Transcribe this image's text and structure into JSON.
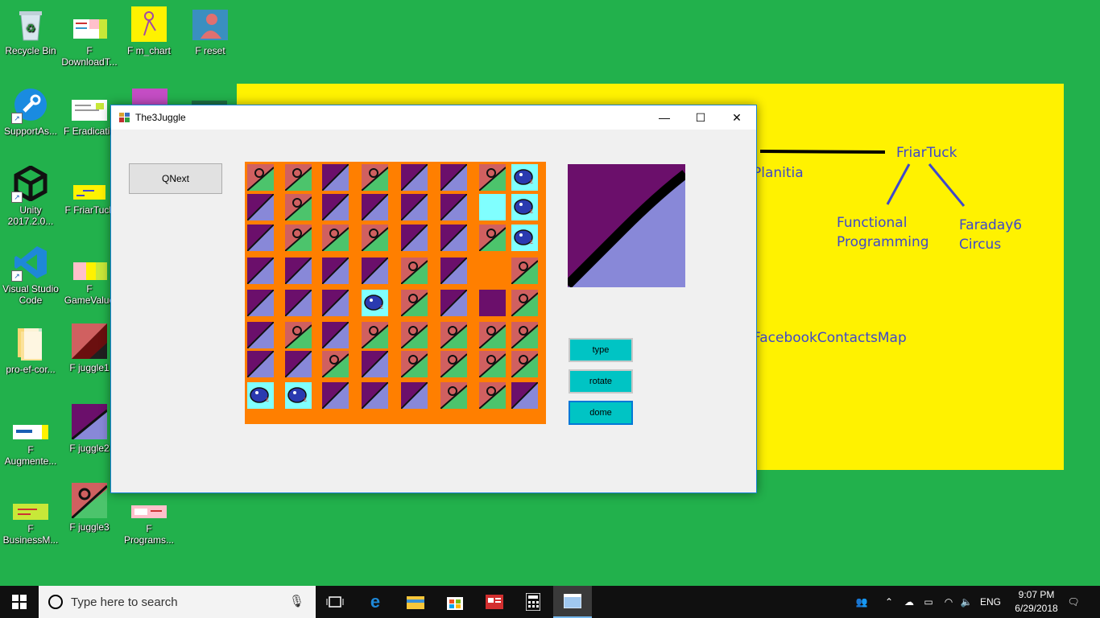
{
  "desktop": {
    "icons": [
      {
        "label": "Recycle Bin"
      },
      {
        "label": "F\nDownloadT..."
      },
      {
        "label": "F m_chart"
      },
      {
        "label": "F reset"
      },
      {
        "label": "SupportAs..."
      },
      {
        "label": "F Eradicatio"
      },
      {
        "label": "Unity\n2017.2.0..."
      },
      {
        "label": "F FriarTuck"
      },
      {
        "label": "Visual Studio\nCode"
      },
      {
        "label": "F\nGameValue"
      },
      {
        "label": "pro-ef-cor..."
      },
      {
        "label": "F juggle1"
      },
      {
        "label": "F\nAugmente..."
      },
      {
        "label": "F juggle2"
      },
      {
        "label": "F\nBusinessM..."
      },
      {
        "label": "F juggle3"
      },
      {
        "label": "F\nPrograms..."
      }
    ],
    "paint": {
      "texts": [
        "FriarTuck",
        "Planitia",
        "Functional\nProgramming",
        "Faraday6\nCircus",
        "FacebookContactsMap"
      ],
      "text_color": "#3f48cc",
      "background": "#fff200"
    }
  },
  "window": {
    "title": "The3Juggle",
    "controls": {
      "minimize": "—",
      "maximize": "☐",
      "close": "✕"
    },
    "qnext_label": "QNext",
    "side_buttons": {
      "type": "type",
      "rotate": "rotate",
      "done": "dome"
    },
    "board": {
      "background": "#ff7f00",
      "rows": 8,
      "cols": 8,
      "tile_kinds": [
        "swirl",
        "split",
        "mountain",
        "dino",
        "solid",
        "cyan",
        "empty"
      ],
      "grid": [
        [
          "swirl",
          "swirl",
          "split",
          "swirl",
          "split",
          "split",
          "swirl",
          "dino"
        ],
        [
          "split",
          "swirl",
          "split",
          "split",
          "split",
          "split",
          "cyan",
          "dino"
        ],
        [
          "split",
          "swirl",
          "swirl",
          "swirl",
          "split",
          "split",
          "swirl",
          "dino"
        ],
        [
          "split",
          "split",
          "split",
          "split",
          "swirl",
          "split",
          "empty",
          "swirl"
        ],
        [
          "split",
          "split",
          "split",
          "dino",
          "swirl",
          "split",
          "solid",
          "swirl"
        ],
        [
          "split",
          "swirl",
          "split",
          "swirl",
          "swirl",
          "swirl",
          "swirl",
          "swirl"
        ],
        [
          "split",
          "split",
          "swirl",
          "split",
          "swirl",
          "swirl",
          "swirl",
          "swirl"
        ],
        [
          "dino",
          "dino",
          "split",
          "split",
          "split",
          "swirl",
          "swirl",
          "split"
        ]
      ]
    },
    "preview_tile": "swirl"
  },
  "taskbar": {
    "search_placeholder": "Type here to search",
    "language": "ENG",
    "time": "9:07 PM",
    "date": "6/29/2018"
  }
}
